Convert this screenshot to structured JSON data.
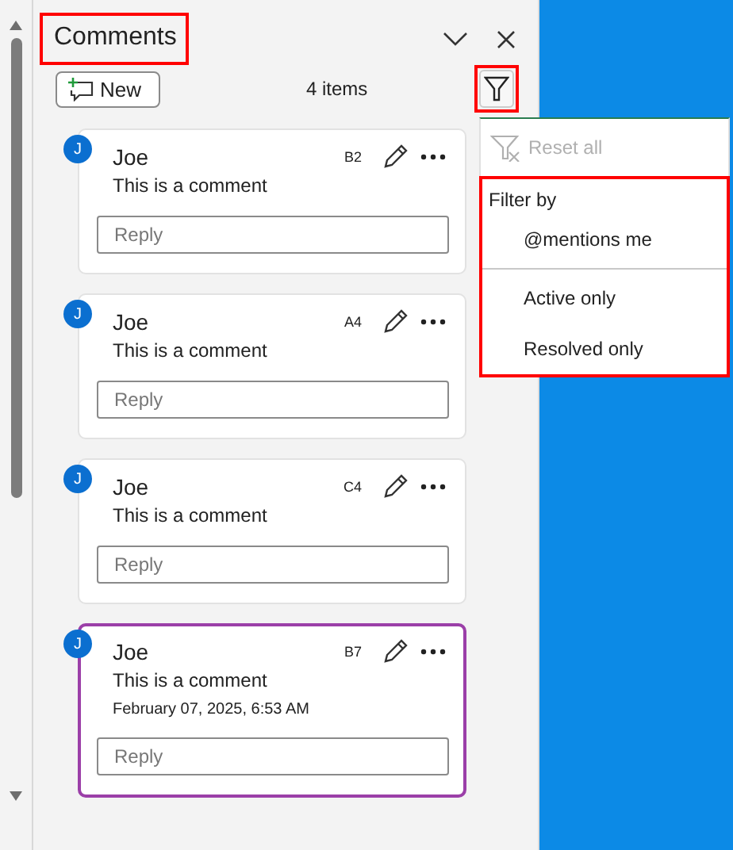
{
  "panel": {
    "title": "Comments",
    "title_highlighted": true,
    "new_button": "New",
    "item_count": "4 items",
    "filter_highlighted": true
  },
  "comments": [
    {
      "initial": "J",
      "author": "Joe",
      "cell": "B2",
      "text": "This is a comment",
      "reply_placeholder": "Reply",
      "selected": false
    },
    {
      "initial": "J",
      "author": "Joe",
      "cell": "A4",
      "text": "This is a comment",
      "reply_placeholder": "Reply",
      "selected": false
    },
    {
      "initial": "J",
      "author": "Joe",
      "cell": "C4",
      "text": "This is a comment",
      "reply_placeholder": "Reply",
      "selected": false
    },
    {
      "initial": "J",
      "author": "Joe",
      "cell": "B7",
      "text": "This is a comment",
      "timestamp": "February 07, 2025, 6:53 AM",
      "reply_placeholder": "Reply",
      "selected": true
    }
  ],
  "filter_menu": {
    "reset_label": "Reset all",
    "reset_disabled": true,
    "section_title": "Filter by",
    "section_highlighted": true,
    "groups": [
      {
        "items": [
          "@mentions me"
        ]
      },
      {
        "items": [
          "Active only",
          "Resolved only"
        ]
      }
    ]
  }
}
